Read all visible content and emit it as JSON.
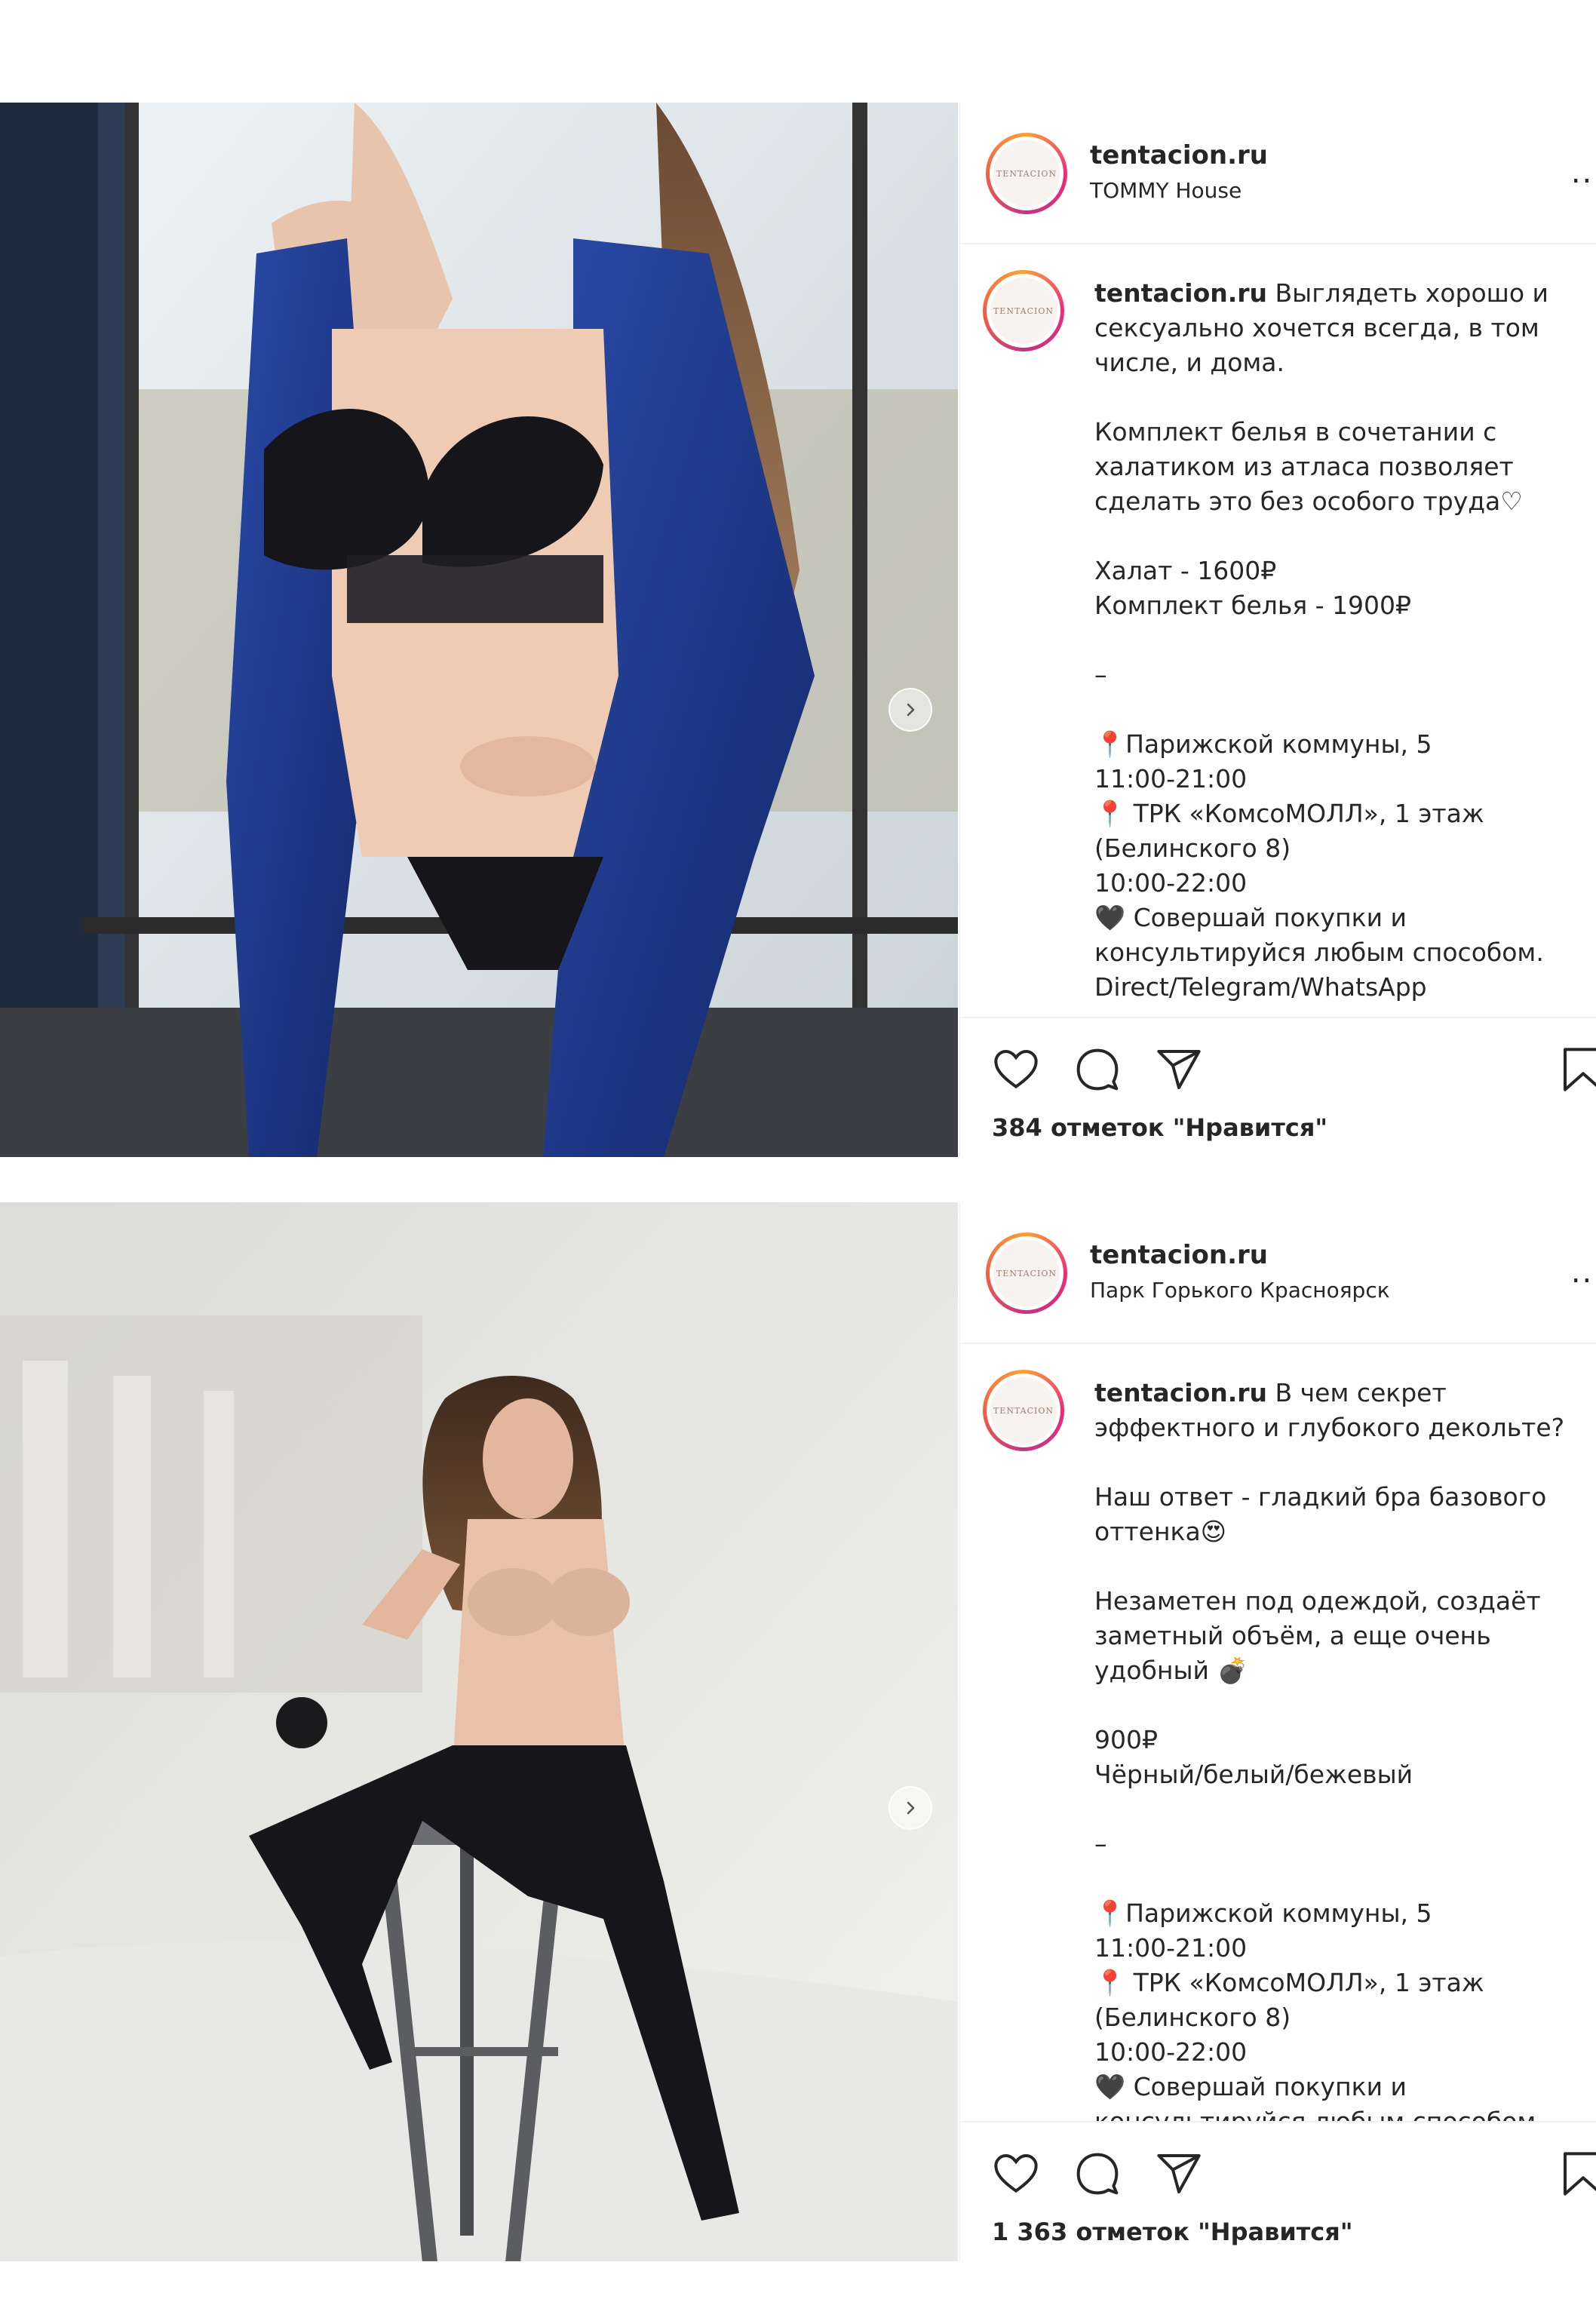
{
  "posts": [
    {
      "username": "tentacion.ru",
      "location": "TOMMY House",
      "more": "...",
      "avatar_text": "TENTACION",
      "caption_username": "tentacion.ru",
      "caption": " Выглядеть хорошо и сексуально хочется всегда, в том числе, и дома.\n\nКомплект белья в сочетании с халатиком из атласа позволяет сделать это без особого труда♡\n\nХалат - 1600₽\nКомплект белья - 1900₽\n\n–\n\n📍Парижской коммуны, 5\n11:00-21:00\n📍 ТРК «КомсоМОЛЛ», 1 этаж (Белинского 8)\n10:00-22:00\n🖤 Совершай покупки и консультируйся любым способом. Direct/Telegram/WhatsApp",
      "likes": "384 отметок \"Нравится\"",
      "next_icon": "chevron-right-icon"
    },
    {
      "username": "tentacion.ru",
      "location": "Парк Горького Красноярск",
      "more": "...",
      "avatar_text": "TENTACION",
      "caption_username": "tentacion.ru",
      "caption": " В чем секрет эффектного и глубокого декольте?\n\nНаш ответ - гладкий бра базового оттенка😍\n\nНезаметен под одеждой, создаёт заметный объём, а еще очень удобный 💣\n\n900₽\nЧёрный/белый/бежевый\n\n–\n\n📍Парижской коммуны, 5\n11:00-21:00\n📍 ТРК «КомсоМОЛЛ», 1 этаж (Белинского 8)\n10:00-22:00\n🖤 Совершай покупки и консультируйся любым способом.",
      "likes": "1 363 отметок \"Нравится\"",
      "next_icon": "chevron-right-icon"
    }
  ],
  "icons": [
    "heart-icon",
    "comment-icon",
    "share-icon",
    "bookmark-icon"
  ],
  "colors": {
    "border": "#efefef",
    "text": "#262626",
    "ring_start": "#f9a13a",
    "ring_end": "#c13584"
  }
}
